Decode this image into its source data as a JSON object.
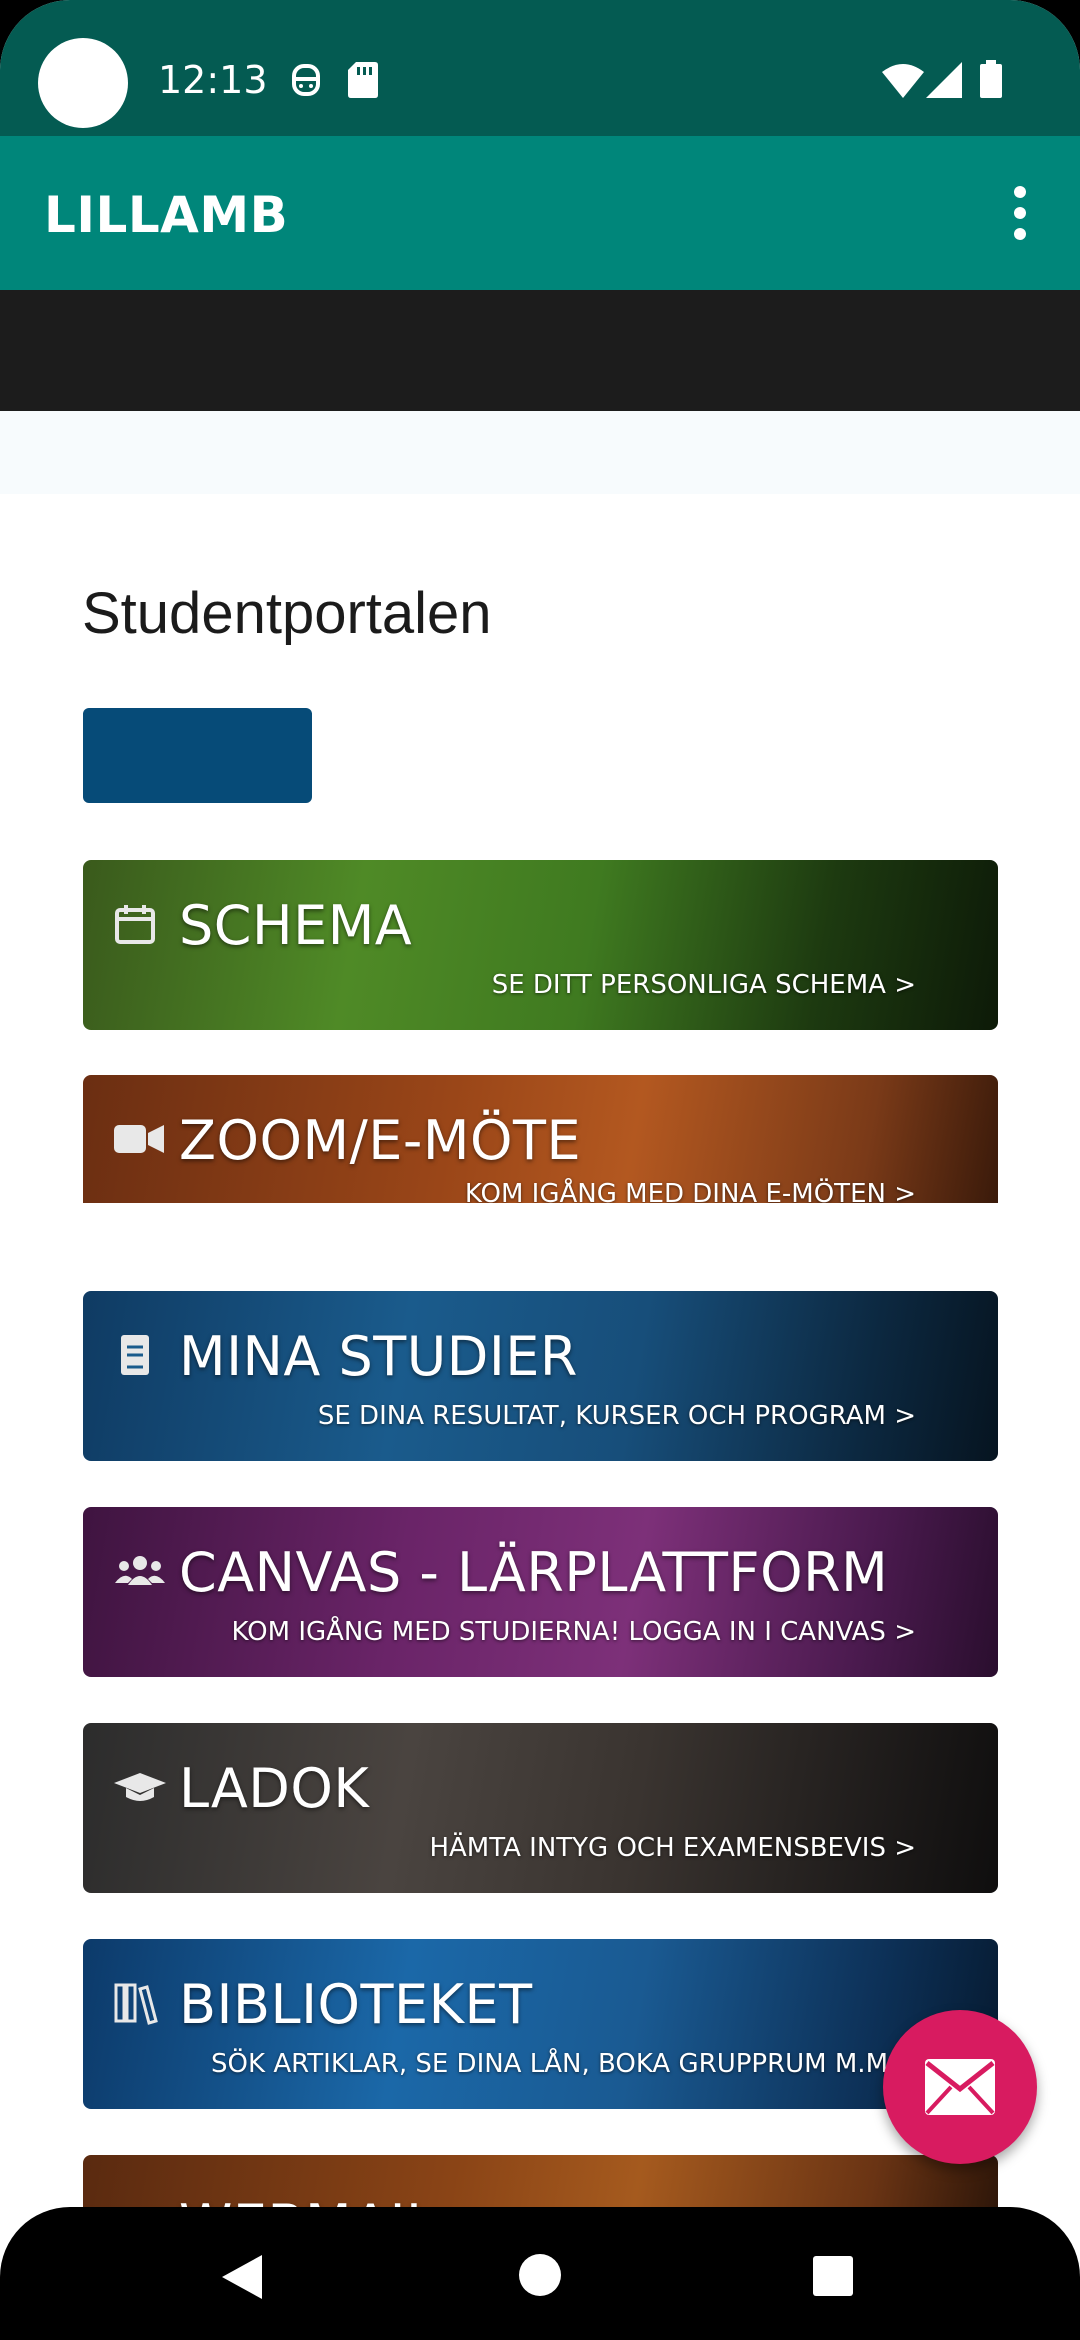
{
  "status_bar": {
    "time": "12:13",
    "icons": [
      "robot-icon",
      "sd-card-icon",
      "wifi-icon",
      "signal-icon",
      "battery-icon"
    ]
  },
  "app_bar": {
    "title": "LILLAMB",
    "menu_icon": "overflow-menu-icon"
  },
  "main": {
    "heading": "Studentportalen",
    "tiles": [
      {
        "title": "SCHEMA",
        "subtitle": "SE DITT PERSONLIGA SCHEMA >",
        "icon": "calendar-icon"
      },
      {
        "title": "ZOOM/E-MÖTE",
        "subtitle": "KOM IGÅNG MED DINA E-MÖTEN >",
        "icon": "video-camera-icon"
      },
      {
        "title": "MINA STUDIER",
        "subtitle": "SE DINA RESULTAT, KURSER OCH PROGRAM >",
        "icon": "book-icon"
      },
      {
        "title": "CANVAS - LÄRPLATTFORM",
        "subtitle": "KOM IGÅNG MED STUDIERNA! LOGGA IN I CANVAS >",
        "icon": "users-icon"
      },
      {
        "title": "LADOK",
        "subtitle": "HÄMTA INTYG OCH EXAMENSBEVIS >",
        "icon": "graduation-cap-icon"
      },
      {
        "title": "BIBLIOTEKET",
        "subtitle": "SÖK ARTIKLAR, SE DINA LÅN, BOKA GRUPPRUM M.M",
        "icon": "library-icon"
      },
      {
        "title": "WEBMAIL",
        "subtitle": "",
        "icon": "mail-icon"
      }
    ]
  },
  "fab": {
    "icon": "envelope-icon",
    "color": "#d81b60"
  },
  "nav_bar": {
    "icons": [
      "back-icon",
      "home-icon",
      "recents-icon"
    ]
  },
  "colors": {
    "status_bar": "#045b52",
    "app_bar": "#00867a",
    "primary_button": "#064b78"
  }
}
